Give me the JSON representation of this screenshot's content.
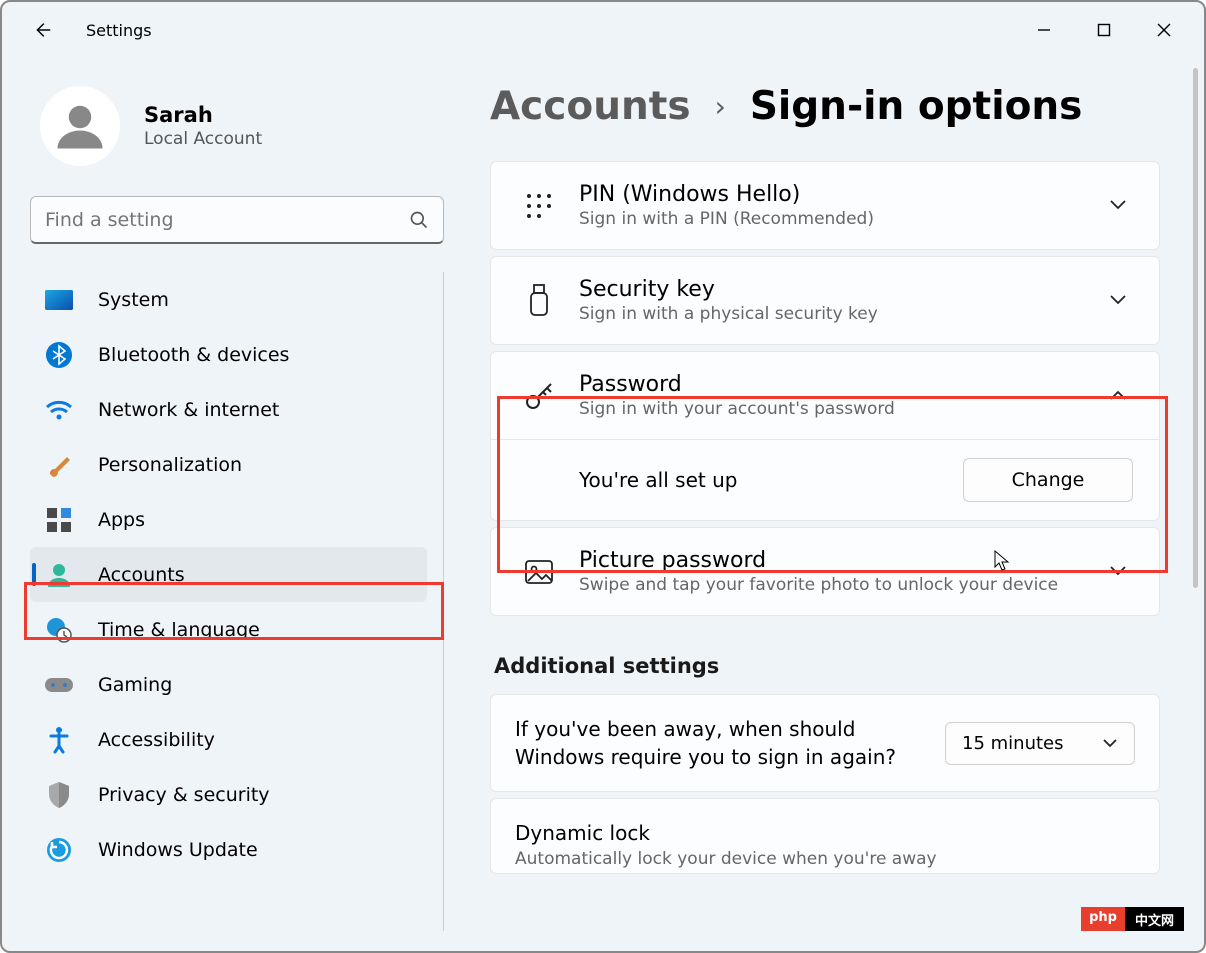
{
  "window": {
    "title": "Settings"
  },
  "profile": {
    "name": "Sarah",
    "account_type": "Local Account"
  },
  "search": {
    "placeholder": "Find a setting"
  },
  "sidebar": {
    "items": [
      {
        "label": "System"
      },
      {
        "label": "Bluetooth & devices"
      },
      {
        "label": "Network & internet"
      },
      {
        "label": "Personalization"
      },
      {
        "label": "Apps"
      },
      {
        "label": "Accounts"
      },
      {
        "label": "Time & language"
      },
      {
        "label": "Gaming"
      },
      {
        "label": "Accessibility"
      },
      {
        "label": "Privacy & security"
      },
      {
        "label": "Windows Update"
      }
    ]
  },
  "breadcrumb": {
    "parent": "Accounts",
    "current": "Sign-in options"
  },
  "options": {
    "pin": {
      "title": "PIN (Windows Hello)",
      "sub": "Sign in with a PIN (Recommended)"
    },
    "seckey": {
      "title": "Security key",
      "sub": "Sign in with a physical security key"
    },
    "password": {
      "title": "Password",
      "sub": "Sign in with your account's password",
      "status": "You're all set up",
      "change_label": "Change"
    },
    "picture": {
      "title": "Picture password",
      "sub": "Swipe and tap your favorite photo to unlock your device"
    }
  },
  "additional": {
    "heading": "Additional settings",
    "away": {
      "text": "If you've been away, when should Windows require you to sign in again?",
      "value": "15 minutes"
    },
    "dynamic": {
      "title": "Dynamic lock",
      "sub": "Automatically lock your device when you're away"
    }
  },
  "watermark": {
    "a": "php",
    "b": "中文网"
  }
}
